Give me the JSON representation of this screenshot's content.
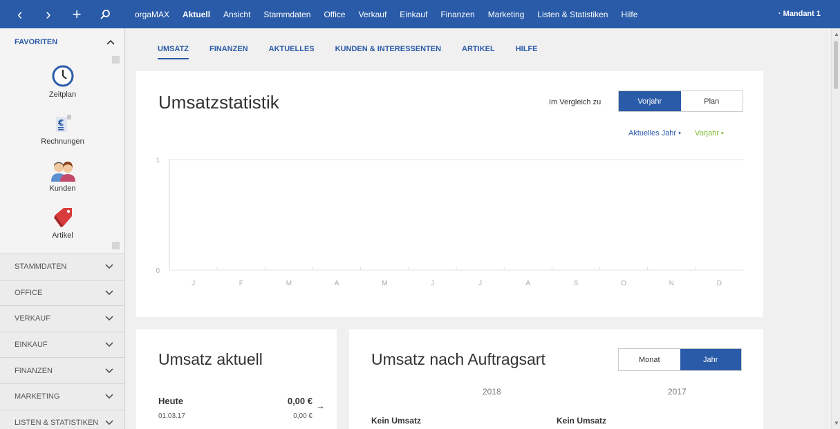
{
  "topbar": {
    "nav_back": "‹",
    "nav_forward": "›",
    "nav_add": "+",
    "nav_search": "⌕",
    "menu": [
      "orgaMAX",
      "Aktuell",
      "Ansicht",
      "Stammdaten",
      "Office",
      "Verkauf",
      "Einkauf",
      "Finanzen",
      "Marketing",
      "Listen & Statistiken",
      "Hilfe"
    ],
    "active_menu": "Aktuell",
    "mandant": "· Mandant 1"
  },
  "sidebar": {
    "favorites_label": "FAVORITEN",
    "favorites": [
      {
        "label": "Zeitplan",
        "icon": "clock-icon"
      },
      {
        "label": "Rechnungen",
        "icon": "invoice-icon"
      },
      {
        "label": "Kunden",
        "icon": "customers-icon"
      },
      {
        "label": "Artikel",
        "icon": "tag-icon"
      }
    ],
    "sections": [
      "STAMMDATEN",
      "OFFICE",
      "VERKAUF",
      "EINKAUF",
      "FINANZEN",
      "MARKETING",
      "LISTEN & STATISTIKEN"
    ]
  },
  "tabs": [
    "UMSATZ",
    "FINANZEN",
    "AKTUELLES",
    "KUNDEN & INTERESSENTEN",
    "ARTIKEL",
    "HILFE"
  ],
  "active_tab": "UMSATZ",
  "statistik": {
    "title": "Umsatzstatistik",
    "compare_label": "Im Vergleich zu",
    "toggle": [
      "Vorjahr",
      "Plan"
    ],
    "toggle_selected": "Vorjahr",
    "legend_current": "Aktuelles Jahr •",
    "legend_previous": "Vorjahr •",
    "colors": {
      "current": "#2a5ba8",
      "previous": "#7ab82e",
      "accent": "#2a5ba8"
    }
  },
  "chart_data": {
    "type": "line",
    "categories": [
      "J",
      "F",
      "M",
      "A",
      "M",
      "J",
      "J",
      "A",
      "S",
      "O",
      "N",
      "D"
    ],
    "series": [
      {
        "name": "Aktuelles Jahr",
        "values": [
          0,
          0,
          0,
          0,
          0,
          0,
          0,
          0,
          0,
          0,
          0,
          0
        ]
      },
      {
        "name": "Vorjahr",
        "values": [
          0,
          0,
          0,
          0,
          0,
          0,
          0,
          0,
          0,
          0,
          0,
          0
        ]
      }
    ],
    "ylim": [
      0,
      1
    ],
    "yticks": [
      "0",
      "1"
    ],
    "grid": true,
    "legend": "top-right"
  },
  "umsatz_aktuell": {
    "title": "Umsatz aktuell",
    "row_label": "Heute",
    "row_date": "01.03.17",
    "row_value": "0,00 €",
    "row_value_prev": "0,00 €",
    "arrow": "→"
  },
  "auftragsart": {
    "title": "Umsatz nach Auftragsart",
    "toggle": [
      "Monat",
      "Jahr"
    ],
    "toggle_selected": "Jahr",
    "year1": "2018",
    "year2": "2017",
    "empty1": "Kein Umsatz",
    "empty2": "Kein Umsatz"
  }
}
